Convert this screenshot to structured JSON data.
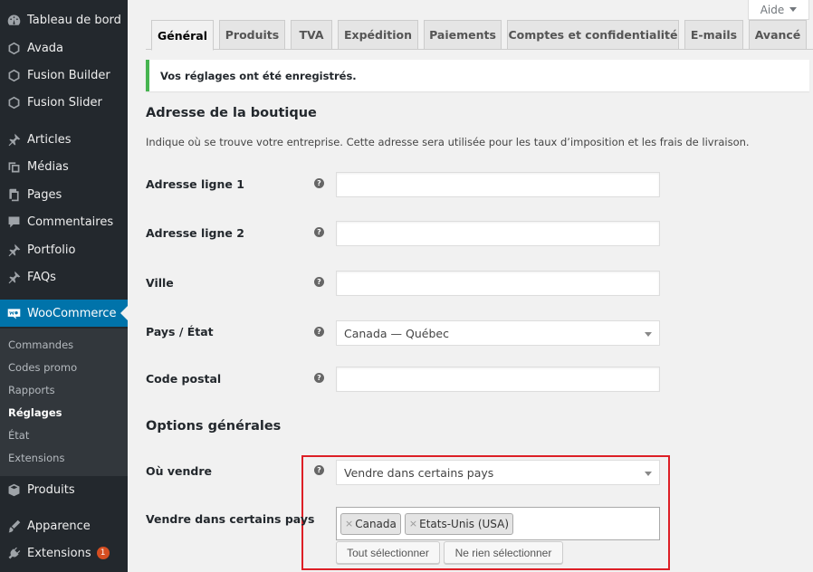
{
  "sidebar": {
    "items": [
      {
        "label": "Tableau de bord",
        "icon": "dashboard-icon"
      },
      {
        "label": "Avada",
        "icon": "avada-icon"
      },
      {
        "label": "Fusion Builder",
        "icon": "fusion-builder-icon"
      },
      {
        "label": "Fusion Slider",
        "icon": "fusion-slider-icon"
      },
      {
        "label": "Articles",
        "icon": "pushpin-icon"
      },
      {
        "label": "Médias",
        "icon": "media-icon"
      },
      {
        "label": "Pages",
        "icon": "pages-icon"
      },
      {
        "label": "Commentaires",
        "icon": "comment-icon"
      },
      {
        "label": "Portfolio",
        "icon": "pushpin-icon"
      },
      {
        "label": "FAQs",
        "icon": "pushpin-icon"
      },
      {
        "label": "WooCommerce",
        "icon": "woocommerce-icon"
      },
      {
        "label": "Produits",
        "icon": "box-icon"
      },
      {
        "label": "Apparence",
        "icon": "brush-icon"
      },
      {
        "label": "Extensions",
        "icon": "plugin-icon",
        "badge": "1"
      }
    ],
    "woocommerce_submenu": [
      "Commandes",
      "Codes promo",
      "Rapports",
      "Réglages",
      "État",
      "Extensions"
    ],
    "active_item": "WooCommerce",
    "current_submenu": "Réglages"
  },
  "help_tab": {
    "label": "Aide"
  },
  "tabs": [
    "Général",
    "Produits",
    "TVA",
    "Expédition",
    "Paiements",
    "Comptes et confidentialité",
    "E-mails",
    "Avancé"
  ],
  "active_tab": "Général",
  "notice": "Vos réglages ont été enregistrés.",
  "store_address": {
    "title": "Adresse de la boutique",
    "description": "Indique où se trouve votre entreprise. Cette adresse sera utilisée pour les taux d’imposition et les frais de livraison.",
    "fields": {
      "address1": {
        "label": "Adresse ligne 1",
        "value": ""
      },
      "address2": {
        "label": "Adresse ligne 2",
        "value": ""
      },
      "city": {
        "label": "Ville",
        "value": ""
      },
      "country": {
        "label": "Pays / État",
        "value": "Canada — Québec"
      },
      "postcode": {
        "label": "Code postal",
        "value": ""
      }
    }
  },
  "general_options": {
    "title": "Options générales",
    "selling_location": {
      "label": "Où vendre",
      "value": "Vendre dans certains pays"
    },
    "specific_countries": {
      "label": "Vendre dans certains pays",
      "selected": [
        "Canada",
        "Etats-Unis (USA)"
      ],
      "select_all": "Tout sélectionner",
      "select_none": "Ne rien sélectionner"
    }
  },
  "colors": {
    "sidebar_bg": "#23282d",
    "active_menu": "#0073aa",
    "notice_success": "#46b450",
    "highlight_border": "#dd1f26",
    "badge": "#d54e21"
  }
}
